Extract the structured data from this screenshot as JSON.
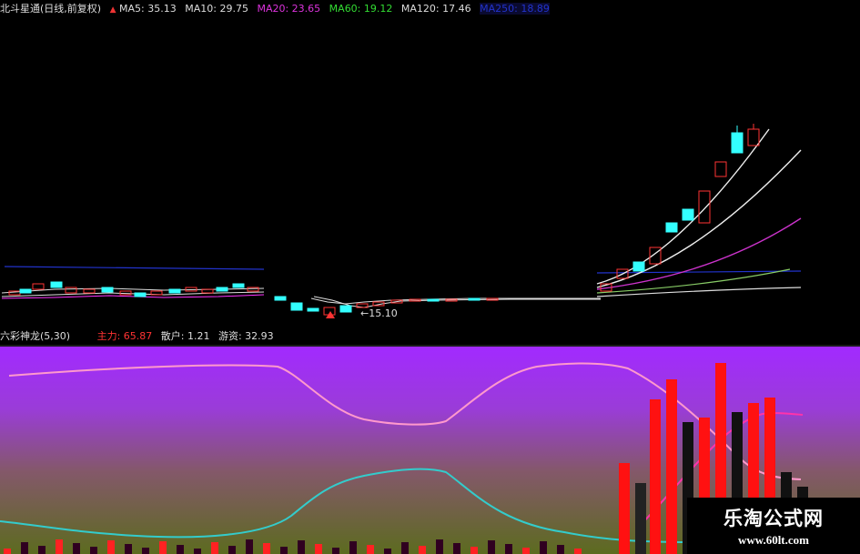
{
  "colors": {
    "ma5": "#ffffff",
    "ma10": "#ffff33",
    "ma20": "#ff33ff",
    "ma60": "#33ff33",
    "ma120": "#cccccc",
    "ma250": "#2233cc",
    "up": "#ff3333",
    "down": "#33ffff",
    "zhuli": "#ff3333",
    "sanhu": "#cc3333",
    "youzi": "#cccccc"
  },
  "price_panel": {
    "title": "北斗星通(日线,前复权)",
    "up_arrow": "▲",
    "ma_items": [
      {
        "label": "MA5: 35.13",
        "color": "#dddddd"
      },
      {
        "label": "MA10: 29.75",
        "color": "#dddddd"
      },
      {
        "label": "MA20: 23.65",
        "color": "#dd33dd"
      },
      {
        "label": "MA60: 19.12",
        "color": "#33dd33"
      },
      {
        "label": "MA120: 17.46",
        "color": "#dddddd"
      },
      {
        "label": "MA250: 18.89",
        "color": "#2233cc"
      }
    ],
    "low_marker": "←15.10"
  },
  "indicator_panel": {
    "title": "六彩神龙(5,30)",
    "items": [
      {
        "label": "主力: 65.87",
        "color": "#ff3333"
      },
      {
        "label": "散户: 1.21",
        "color": "#dddddd"
      },
      {
        "label": "游资: 32.93",
        "color": "#dddddd"
      }
    ]
  },
  "watermark": {
    "title": "乐淘公式网",
    "url": "www.60lt.com"
  }
}
